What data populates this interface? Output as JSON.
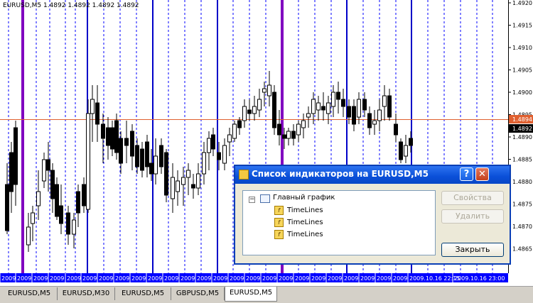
{
  "chart": {
    "symbol_label": "EURUSD,M5  1.4892 1.4892 1.4892 1.4892",
    "price_ticks": [
      "1.4920",
      "1.4915",
      "1.4910",
      "1.4905",
      "1.4900",
      "1.4895",
      "1.4890",
      "1.4885",
      "1.4880",
      "1.4875",
      "1.4870",
      "1.4865"
    ],
    "current_price_line": "1.4894",
    "last_price": "1.4892",
    "time_labels": [
      "2009",
      "2009",
      "2009",
      "2009",
      "2009",
      "2009",
      "2009",
      "2009",
      "2009",
      "2009",
      "2009",
      "2009",
      "2009",
      "2009",
      "2009",
      "2009",
      "2009",
      "2009",
      "2009",
      "2009",
      "2009",
      "2009",
      "2009",
      "2009",
      "2009",
      "2009.10.16 22:15",
      "2009.10.16 23:00"
    ],
    "colors": {
      "bull_candle": "#ffffff",
      "bear_candle": "#000000",
      "price_line": "#e06030",
      "solid_vline": "#0000c8",
      "purple_vline": "#8000c0",
      "dashed_vline": "#0000ff",
      "axis_bar": "#0000ff"
    }
  },
  "tabs": [
    {
      "label": "EURUSD,M5"
    },
    {
      "label": "EURUSD,M30"
    },
    {
      "label": "EURUSD,M5"
    },
    {
      "label": "GBPUSD,M5"
    },
    {
      "label": "EURUSD,M5"
    }
  ],
  "dialog": {
    "title": "Список индикаторов на EURUSD,M5",
    "tree_root": "Главный график",
    "indicators": [
      "TimeLines",
      "TimeLines",
      "TimeLines"
    ],
    "buttons": {
      "properties": "Свойства",
      "delete": "Удалить",
      "close": "Закрыть"
    },
    "help_glyph": "?",
    "close_glyph": "✕"
  }
}
